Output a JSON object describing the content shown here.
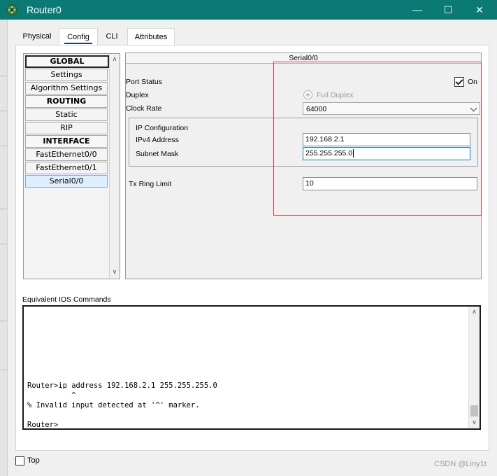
{
  "window": {
    "title": "Router0",
    "minimize_glyph": "—",
    "maximize_glyph": "☐",
    "close_glyph": "✕"
  },
  "tabs": [
    {
      "label": "Physical"
    },
    {
      "label": "Config",
      "active": true
    },
    {
      "label": "CLI"
    },
    {
      "label": "Attributes"
    }
  ],
  "nav": {
    "global": "GLOBAL",
    "settings": "Settings",
    "algorithm_settings": "Algorithm Settings",
    "routing": "ROUTING",
    "static": "Static",
    "rip": "RIP",
    "interface": "INTERFACE",
    "fa00": "FastEthernet0/0",
    "fa01": "FastEthernet0/1",
    "serial00": "Serial0/0",
    "scroll_up": "∧",
    "scroll_down": "∨"
  },
  "serial": {
    "title": "Serial0/0",
    "port_status_label": "Port Status",
    "port_status_on_label": "On",
    "port_status_on": true,
    "duplex_label": "Duplex",
    "duplex_value": "Full Duplex",
    "clock_rate_label": "Clock Rate",
    "clock_rate_value": "64000",
    "ip_config_label": "IP Configuration",
    "ipv4_label": "IPv4 Address",
    "ipv4_value": "192.168.2.1",
    "mask_label": "Subnet Mask",
    "mask_value": "255.255.255.0",
    "tx_ring_label": "Tx Ring Limit",
    "tx_ring_value": "10"
  },
  "console": {
    "label": "Equivalent IOS Commands",
    "line1": "Router>ip address 192.168.2.1 255.255.255.0",
    "line2": "          ^",
    "line3": "% Invalid input detected at '^' marker.",
    "line4": "Router>",
    "scroll_up": "∧",
    "scroll_down": "∨"
  },
  "footer": {
    "top_label": "Top",
    "watermark": "CSDN @Liny1t"
  },
  "colors": {
    "titlebar": "#0b7a75",
    "highlight_box": "#d33a3a",
    "selected_nav": "#dfeefc"
  }
}
